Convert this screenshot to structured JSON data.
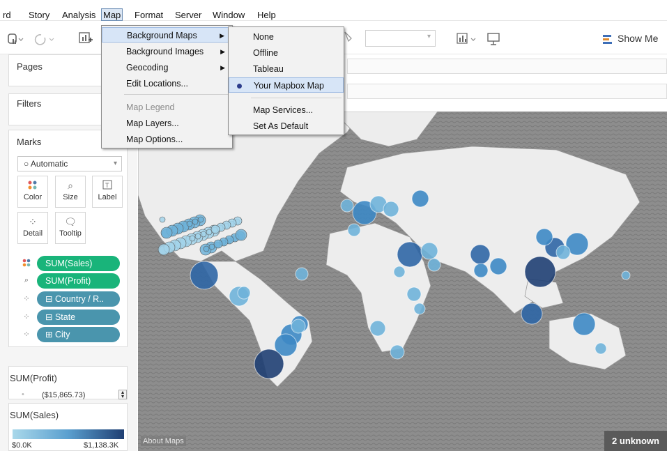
{
  "menubar": {
    "items": [
      "rd",
      "Story",
      "Analysis",
      "Map",
      "Format",
      "Server",
      "Window",
      "Help"
    ],
    "active_index": 3
  },
  "toolbar": {
    "show_me_label": "Show Me"
  },
  "left_pane": {
    "pages_title": "Pages",
    "filters_title": "Filters",
    "marks_title": "Marks",
    "mark_type": "Automatic",
    "mark_buttons": [
      "Color",
      "Size",
      "Label",
      "Detail",
      "Tooltip"
    ],
    "pills": [
      {
        "icon": "color-dots-icon",
        "label": "SUM(Sales)",
        "color": "#19b47a"
      },
      {
        "icon": "size-icon",
        "label": "SUM(Profit)",
        "color": "#19b47a"
      },
      {
        "icon": "detail-icon",
        "label": "⊟ Country / R..",
        "color": "#4a95ad"
      },
      {
        "icon": "detail-icon",
        "label": "⊟ State",
        "color": "#4a95ad"
      },
      {
        "icon": "detail-icon",
        "label": "⊞ City",
        "color": "#4a95ad"
      }
    ],
    "profit_legend": {
      "title": "SUM(Profit)",
      "value": "($15,865.73)"
    },
    "sales_legend": {
      "title": "SUM(Sales)",
      "min": "$0.0K",
      "max": "$1,138.3K",
      "gradient_from": "#a9d8ea",
      "gradient_to": "#1f3f73"
    }
  },
  "map_menu": {
    "items": [
      {
        "label": "Background Maps",
        "submenu": true,
        "highlighted": true
      },
      {
        "label": "Background Images",
        "submenu": true
      },
      {
        "label": "Geocoding",
        "submenu": true
      },
      {
        "label": "Edit Locations..."
      },
      {
        "label": "Map Legend",
        "disabled": true
      },
      {
        "label": "Map Layers..."
      },
      {
        "label": "Map Options..."
      }
    ]
  },
  "background_maps_submenu": {
    "items": [
      {
        "label": "None"
      },
      {
        "label": "Offline"
      },
      {
        "label": "Tableau"
      },
      {
        "label": "Your Mapbox Map",
        "selected": true
      },
      {
        "label": "Map Services..."
      },
      {
        "label": "Set As Default"
      }
    ]
  },
  "map": {
    "about_label": "About Maps",
    "unknown_label": "2 unknown",
    "bubble_colors": [
      "#a3d4ea",
      "#6fb3d9",
      "#3d88c4",
      "#2f66a5",
      "#1f3f73"
    ]
  }
}
